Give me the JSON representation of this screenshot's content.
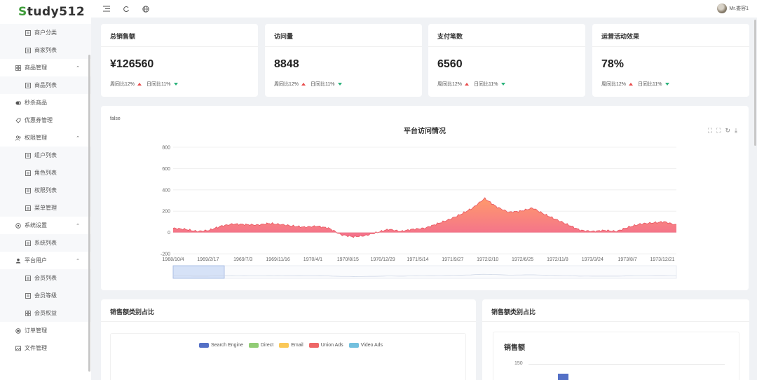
{
  "logo": {
    "first": "S",
    "rest": "tudy512"
  },
  "sidebar": {
    "items": [
      {
        "label": "商户分类",
        "icon": "list-icon",
        "sub": true
      },
      {
        "label": "商家列表",
        "icon": "list-icon",
        "sub": true
      },
      {
        "label": "商品管理",
        "icon": "grid-icon",
        "sub": false,
        "expanded": true
      },
      {
        "label": "商品列表",
        "icon": "list-icon",
        "sub": true
      },
      {
        "label": "秒杀商品",
        "icon": "coins-icon",
        "sub": false
      },
      {
        "label": "优惠券管理",
        "icon": "tag-icon",
        "sub": false
      },
      {
        "label": "权限管理",
        "icon": "users-icon",
        "sub": false,
        "expanded": true
      },
      {
        "label": "组户列表",
        "icon": "list-icon",
        "sub": true
      },
      {
        "label": "角色列表",
        "icon": "list-icon",
        "sub": true
      },
      {
        "label": "权限列表",
        "icon": "list-icon",
        "sub": true
      },
      {
        "label": "菜单管理",
        "icon": "list-icon",
        "sub": true
      },
      {
        "label": "系统设置",
        "icon": "gear-icon",
        "sub": false,
        "expanded": true
      },
      {
        "label": "系统列表",
        "icon": "list-icon",
        "sub": true
      },
      {
        "label": "平台用户",
        "icon": "user-icon",
        "sub": false,
        "expanded": true
      },
      {
        "label": "会员列表",
        "icon": "list-icon",
        "sub": true
      },
      {
        "label": "会员等级",
        "icon": "list-icon",
        "sub": true
      },
      {
        "label": "会员权益",
        "icon": "grid-icon",
        "sub": true
      },
      {
        "label": "订单管理",
        "icon": "order-icon",
        "sub": false
      },
      {
        "label": "文件管理",
        "icon": "image-icon",
        "sub": false
      }
    ]
  },
  "topbar": {
    "user_name": "Mr.娄容1"
  },
  "stats": [
    {
      "title": "总销售额",
      "value": "¥126560",
      "week": "周同比12%",
      "day": "日同比11%"
    },
    {
      "title": "访问量",
      "value": "8848",
      "week": "周同比12%",
      "day": "日同比11%"
    },
    {
      "title": "支付笔数",
      "value": "6560",
      "week": "周同比12%",
      "day": "日同比11%"
    },
    {
      "title": "运营活动效果",
      "value": "78%",
      "week": "周同比12%",
      "day": "日同比11%"
    }
  ],
  "main_chart": {
    "flag_text": "false",
    "chart_data": {
      "type": "area",
      "title": "平台访问情况",
      "ylim": [
        -200,
        800
      ],
      "yticks": [
        -200,
        0,
        200,
        400,
        600,
        800
      ],
      "xticks": [
        "1968/10/4",
        "1969/2/17",
        "1969/7/3",
        "1969/11/16",
        "1970/4/1",
        "1970/8/15",
        "1970/12/29",
        "1971/5/14",
        "1971/9/27",
        "1972/2/10",
        "1972/6/25",
        "1972/11/8",
        "1973/3/24",
        "1973/8/7",
        "1973/12/21"
      ],
      "series": [
        {
          "values": [
            40,
            30,
            10,
            20,
            60,
            80,
            75,
            70,
            85,
            75,
            60,
            50,
            60,
            40,
            -20,
            -40,
            -30,
            0,
            30,
            10,
            30,
            40,
            80,
            120,
            170,
            230,
            320,
            240,
            190,
            200,
            230,
            170,
            120,
            70,
            20,
            10,
            20,
            10,
            50,
            80,
            90,
            100,
            70
          ]
        }
      ]
    }
  },
  "panel_left": {
    "title": "销售额类别占比",
    "legend": [
      {
        "name": "Search Engine",
        "color": "#5470c6"
      },
      {
        "name": "Direct",
        "color": "#91cc75"
      },
      {
        "name": "Email",
        "color": "#fac858"
      },
      {
        "name": "Union Ads",
        "color": "#ee6666"
      },
      {
        "name": "Video Ads",
        "color": "#73c0de"
      }
    ]
  },
  "panel_right": {
    "title": "销售额类别占比",
    "chart_data": {
      "type": "bar",
      "title": "销售额",
      "yticks": [
        150
      ],
      "values": [
        150
      ]
    }
  }
}
